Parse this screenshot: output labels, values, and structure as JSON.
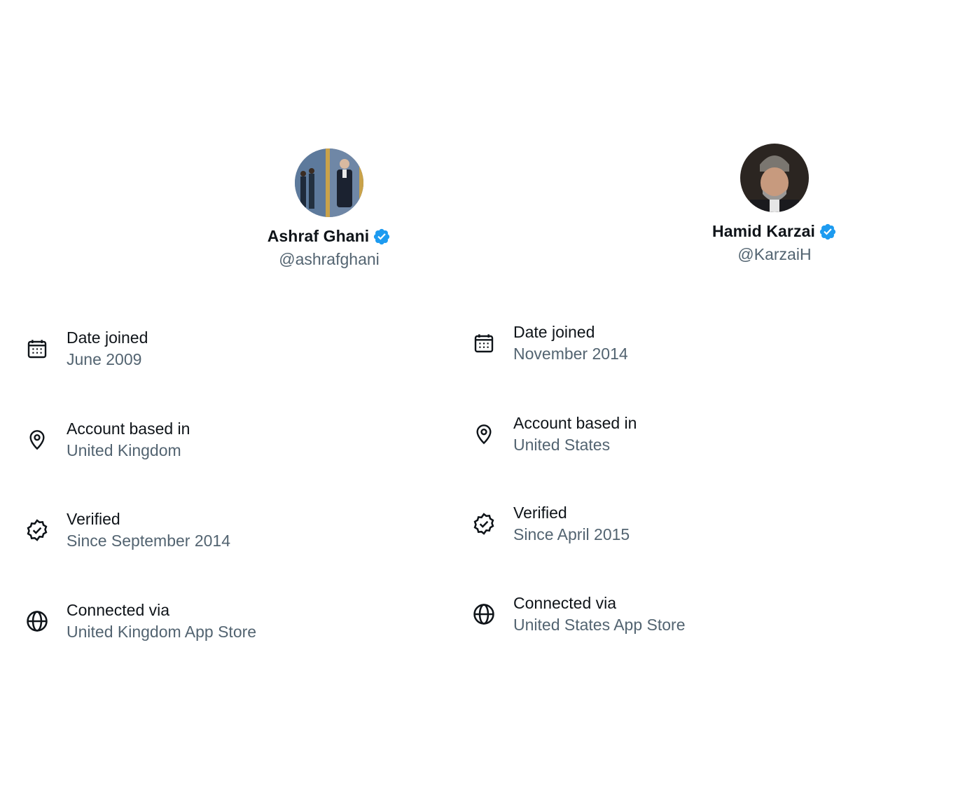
{
  "profiles": [
    {
      "name": "Ashraf Ghani",
      "handle": "@ashrafghani",
      "avatar": "portrait photo of man walking past honor guard",
      "details": [
        {
          "icon": "calendar-icon",
          "label": "Date joined",
          "value": "June 2009"
        },
        {
          "icon": "location-pin-icon",
          "label": "Account based in",
          "value": "United Kingdom"
        },
        {
          "icon": "verified-badge-icon",
          "label": "Verified",
          "value": "Since September 2014"
        },
        {
          "icon": "globe-icon",
          "label": "Connected via",
          "value": "United Kingdom App Store"
        }
      ]
    },
    {
      "name": "Hamid Karzai",
      "handle": "@KarzaiH",
      "avatar": "portrait photo of man in karakul hat",
      "details": [
        {
          "icon": "calendar-icon",
          "label": "Date joined",
          "value": "November 2014"
        },
        {
          "icon": "location-pin-icon",
          "label": "Account based in",
          "value": "United States"
        },
        {
          "icon": "verified-badge-icon",
          "label": "Verified",
          "value": "Since April 2015"
        },
        {
          "icon": "globe-icon",
          "label": "Connected via",
          "value": "United States App Store"
        }
      ]
    }
  ],
  "colors": {
    "verified_blue": "#1d9bf0",
    "secondary_text": "#536471",
    "primary_text": "#0f1419"
  }
}
